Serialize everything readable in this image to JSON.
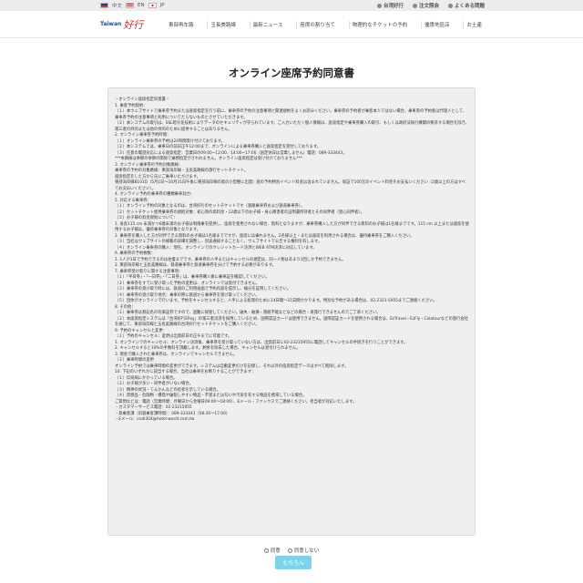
{
  "topbar": {
    "languages": [
      {
        "label": "中文"
      },
      {
        "label": "EN"
      },
      {
        "label": "JP"
      }
    ],
    "links": [
      "台湾好行",
      "注文照会",
      "よくある問題"
    ]
  },
  "nav": {
    "logo_text": "Taiwan",
    "logo_mark": "好行",
    "items": [
      "東部再车路",
      "玉長美路線",
      "最新ニュース",
      "座席の割り当て",
      "物理的なチケットの予約",
      "優惠地區店",
      "お土產"
    ]
  },
  "page": {
    "title": "オンライン座席予約同意書"
  },
  "agreement_lines": [
    "・オンライン座席指定同意書・",
    "1. 乗客予約契約：",
    "（１）本ウェブサイトで乗車券予約または座席指定を行う前に、乗車券の予約の注意事項と関連規約をよくお読みください。乗車券の予約者が乗客本人ではない場合、乗車券の予約者は代理人として、乗車券予約の注意事項と利用についてたらないものとさせていただきます。",
    "（２）本システムの取引は、SSL暗号化技術によりデータのセキュリティが守られています。ご入力いただく個人情報は、座席指定や乗車券購入の取引、もしくは政府法執行機関の要求する場合を除き、第三者の目的または他の目的のために提供することはありません。",
    "2. オンライン乗車券予約時間：",
    "（１）オンライン乗車券の予約は24時間受け付けております。",
    "（２）本システムでは、乗車日の前日正午12:00まで、オンラインによる乗車券購入と座席指定を受付しております。",
    "（３）任意の電話対応による座席指定：営業日の09:00~12:00、14:00~17:00（国定休日は営業しません）電話：089-333443。",
    "***本路線は季節の季節の関係で乗務指定がされれません。オンライン座席指定は受け付けておりません***",
    "3. オンライン乗車券の予約対象路線：",
    "乗車券の予約の対象路線：東部海岸線・玉長美路線の旅行セットチケット。",
    "座席指定をした方から先にご乗車いただけます。",
    "東部海岸線B101D（5月1日～10月31日午後に東部海岸線の第の小型観に出発）座の予約特別イベント料金は含まれていません。保証で100元のイベント料金をお支払いください（2歳以上の方はすべてお支払いください）。",
    "4. オンライン予約の乗車券の種類乗車効力：",
    "5. 対応する乗車券：",
    "（１）オンライン予約の対象となるのは、台湾好行のセットチケットです（鉄路乗車券および鉄道乗車券）。",
    "（２）セットチケット使用乗車券の規則対象：初心到の高料金・12歳以下のお子様・身心障害者の証明書所持者とその同伴者（登心同伴者）。",
    "（３）お子様の料金規則について：",
    "1. 身長115 cm 未満かつ6歳未満のお子様は制限乗を提供し、座席を使用されない場合、無料となりますが、乗車券購入した方が同伴できる無料のお子様は1名様までです。115 cm 以上または座席を使用するお子様は、優待乗車券の対象となります。",
    "2. 乗車券を購入した方が同伴できる無料のお子様は1名様までですが、座席には乗れません。2名様以上・または座席を利用される場合は、優待乗車券をご購入ください。",
    "（３）当社はウェブサイトの掲載の詳細を調整し、別途通知することなく、ウェブサイトで公告する権利を有します。",
    "（４）オンライン乗車券の購入：現在、オンラインでのクレジットカード決済とWEB ATM決済に対応しています。",
    "6. 乗車券の予約枚数：",
    "1. 1人が1日で予約できるのは往復までです。乗車券の人手またはキャンセルの規定は、同一人物はあまり1回しか予約できません。",
    "2. 東部海岸線と玉長美路線は、鉄道乗車券と鉄道乗車券を分けて予約する必要があります。",
    "7. 乗車券受け取りに関する注意事項：",
    "（１）「半日券」・「一日券」・「二日券」は、乗車券購入後に乗車証を確認してください。",
    "（２）乗車券をすでに受け取った予約の変更は、オンラインでは受付できません。",
    "（３）乗車券の受け取り時には、鉄道のご利用画面で予約内容を提示し、検分を証明してください。",
    "（４）乗車券の受け取り地点：乗車の際に鉄道から乗車券を受け取ってください。",
    "（５）団体がオンラインで行います。予約をキャンセルすると、人手による処理のために14日間～21日間かかります。特別な予約がある場合は、02-2321-5955までご連絡ください。",
    "8. その他：",
    "（１）乗車券は無記名の有価証券ですので、盗難に保管してください。破失・破損・落紙不能などなどの場合・再発行できませんのでご了承ください。",
    "（２）本座席指定システムは「台湾好行EPay」の第三者決済を採用しているため、国際認証カードは使用できません。国際認証カードを使用される場合は、EzTravel・EzFly・Colatourなどの旅行会社を通じて、東部海岸線と玉長美路線の台湾好行セットチケットをご購入ください。",
    "9. 予約のキャンセルと変更：",
    "（１）予約のキャンセル：変更は出発前日の正午までに可能です。",
    "1. オンラインでのキャンセル：オンライン決済後、乗車券を受け取っていない方は、出発前日に02-23215955に電話してキャンセルの手続きを行うことができます。",
    "2. キャンセルすると10%の手数料を頂戴します。剰余を除去した場合、キャンセルは受付けられません。",
    "3. 現金で購入された乗車券は、オンラインでキャンセルできません。",
    "（２）乗車時間の変更",
    "オンライン予約では乗車時間の変更ができます。システムは自動変更だけを記録し、それ以外の座席指定データはすべて削除します。",
    "10. 下記のいずれかに該当する場合、当社は乗車をお断りすることができます：",
    "（１）伝染病にかかっている場合。",
    "（２）お子様が多い・同伴者がいない場合。",
    "（３）精神の状況・てんかんなどの症状を示している場合。",
    "（４）禁煙品・危険物・爆発や破裂しやすい物品・不潔または匂いや汚染を有する物品を携帯している場合。",
    "ご質問などは：電話（営業時間：月曜日から金曜日09:00～18:00）、Eメール・ファックスでご連絡ください。担当者が対応いたします。",
    "・カスタマーサービス電話：02-23215955",
    "・鉄乗客課（旧鉄乗客課時間）：089-333443（08:30～17:00）",
    "・Eメール：ina0304@hotel-world.com.tw"
  ],
  "consent": {
    "agree_label": "同意",
    "disagree_label": "同意しない"
  },
  "submit_label": "もちろん"
}
